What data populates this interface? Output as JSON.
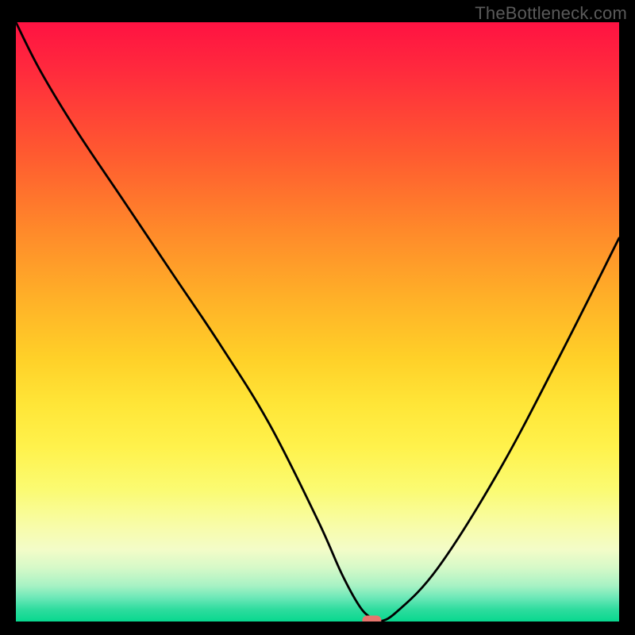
{
  "watermark": "TheBottleneck.com",
  "colors": {
    "page_bg": "#000000",
    "curve_stroke": "#000000",
    "marker_fill": "#e6756d",
    "watermark_text": "#5a5a5a"
  },
  "chart_data": {
    "type": "line",
    "title": "",
    "xlabel": "",
    "ylabel": "",
    "xlim": [
      0,
      100
    ],
    "ylim": [
      0,
      100
    ],
    "x": [
      0,
      4,
      10,
      18,
      26,
      34,
      42,
      50,
      54,
      57,
      59,
      60,
      63,
      70,
      80,
      90,
      100
    ],
    "values": [
      100,
      92,
      82,
      70,
      58,
      46,
      33,
      17,
      8,
      2.5,
      0.5,
      0,
      1.5,
      9,
      25,
      44,
      64
    ],
    "annotations": [
      {
        "type": "marker",
        "x": 59,
        "y": 0.2,
        "shape": "pill"
      }
    ],
    "background_gradient_stops": [
      {
        "pos": 0.0,
        "color": "#ff1242"
      },
      {
        "pos": 0.08,
        "color": "#ff2a3d"
      },
      {
        "pos": 0.22,
        "color": "#ff5a30"
      },
      {
        "pos": 0.35,
        "color": "#ff8a2a"
      },
      {
        "pos": 0.46,
        "color": "#ffb028"
      },
      {
        "pos": 0.56,
        "color": "#ffd028"
      },
      {
        "pos": 0.64,
        "color": "#ffe638"
      },
      {
        "pos": 0.71,
        "color": "#fff24c"
      },
      {
        "pos": 0.78,
        "color": "#fbfb72"
      },
      {
        "pos": 0.84,
        "color": "#f8fca8"
      },
      {
        "pos": 0.88,
        "color": "#f3fcc8"
      },
      {
        "pos": 0.91,
        "color": "#d6f9c8"
      },
      {
        "pos": 0.94,
        "color": "#a8f2c4"
      },
      {
        "pos": 0.96,
        "color": "#6de8b8"
      },
      {
        "pos": 0.98,
        "color": "#2edc9e"
      },
      {
        "pos": 1.0,
        "color": "#08d88f"
      }
    ]
  }
}
